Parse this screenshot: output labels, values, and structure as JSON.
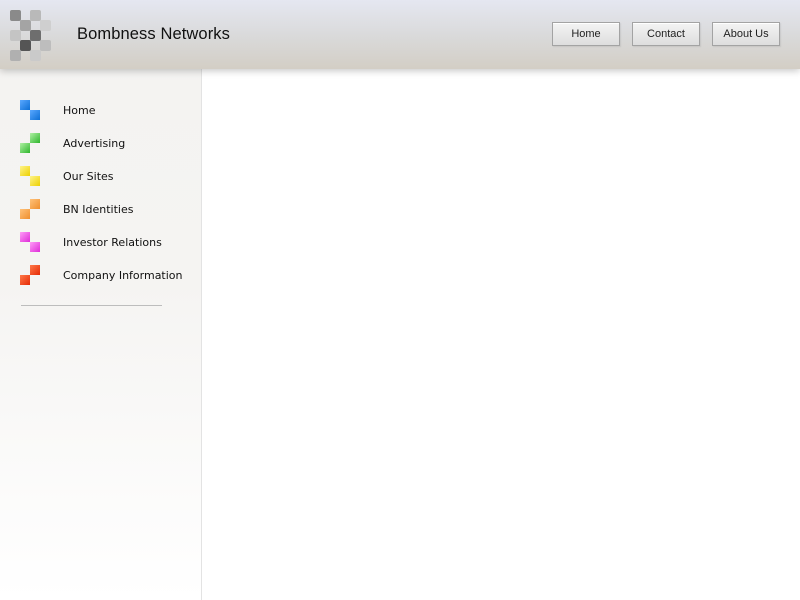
{
  "header": {
    "site_title": "Bombness Networks",
    "logo_icon": "checker-logo-icon",
    "buttons": [
      {
        "label": "Home"
      },
      {
        "label": "Contact"
      },
      {
        "label": "About Us"
      }
    ]
  },
  "sidebar": {
    "items": [
      {
        "label": "Home",
        "icon": "blue-squares-icon",
        "color": "#1a7ee8"
      },
      {
        "label": "Advertising",
        "icon": "green-squares-icon",
        "color": "#3cc23a"
      },
      {
        "label": "Our Sites",
        "icon": "yellow-squares-icon",
        "color": "#f2d600"
      },
      {
        "label": "BN Identities",
        "icon": "orange-squares-icon",
        "color": "#f29a3c"
      },
      {
        "label": "Investor Relations",
        "icon": "magenta-squares-icon",
        "color": "#e63de0"
      },
      {
        "label": "Company Information",
        "icon": "red-squares-icon",
        "color": "#ef3a12"
      }
    ]
  }
}
